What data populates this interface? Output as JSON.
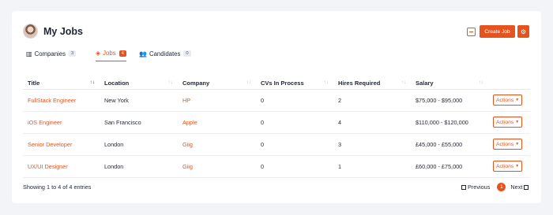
{
  "header": {
    "title": "My Jobs",
    "create_label": "Create Job",
    "settings_icon": "gear-icon",
    "collapse_icon": "minus-square-icon"
  },
  "tabs": [
    {
      "label": "Companies",
      "count": "3",
      "icon": "building-icon",
      "active": false
    },
    {
      "label": "Jobs",
      "count": "4",
      "icon": "layers-icon",
      "active": true
    },
    {
      "label": "Candidates",
      "count": "0",
      "icon": "users-icon",
      "active": false
    }
  ],
  "table": {
    "columns": [
      "Title",
      "Location",
      "Company",
      "CVs In Process",
      "Hires Required",
      "Salary"
    ],
    "rows": [
      {
        "title": "FullStack Engineer",
        "location": "New York",
        "company": "HP",
        "cvs": "0",
        "hires": "2",
        "salary": "$75,000 - $95,000",
        "action": "Actions"
      },
      {
        "title": "iOS Engineer",
        "location": "San Francisco",
        "company": "Apple",
        "cvs": "0",
        "hires": "4",
        "salary": "$110,000 - $120,000",
        "action": "Actions"
      },
      {
        "title": "Senior Developer",
        "location": "London",
        "company": "Giig",
        "cvs": "0",
        "hires": "3",
        "salary": "£45,000 - £55,000",
        "action": "Actions"
      },
      {
        "title": "UX/UI Designer",
        "location": "London",
        "company": "Giig",
        "cvs": "0",
        "hires": "1",
        "salary": "£60,000 - £75,000",
        "action": "Actions"
      }
    ]
  },
  "footer": {
    "info": "Showing 1 to 4 of 4 entries",
    "previous": "Previous",
    "page": "1",
    "next": "Next"
  },
  "colors": {
    "accent": "#e5541d",
    "background": "#f3f4f8"
  }
}
